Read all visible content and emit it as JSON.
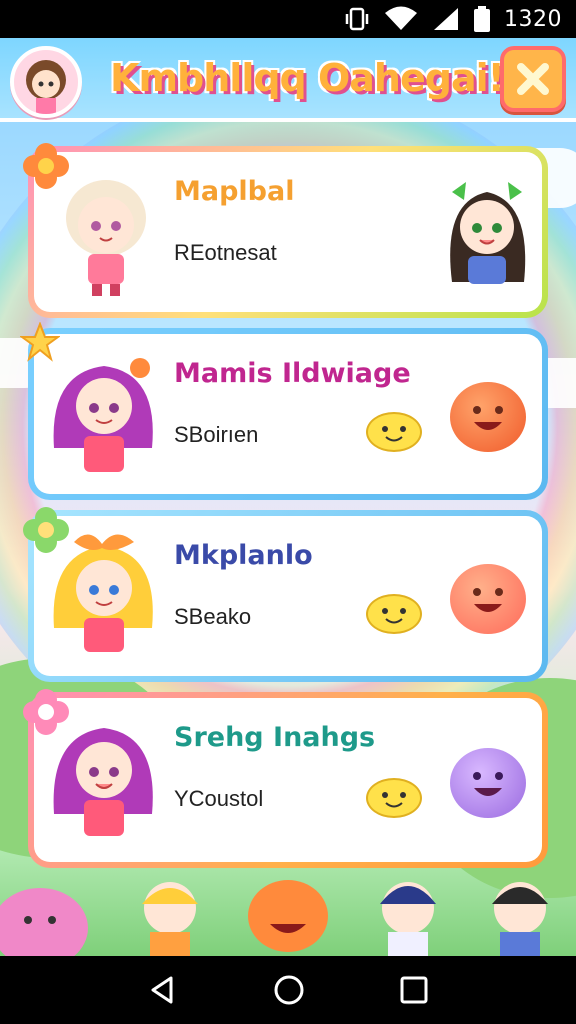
{
  "status_bar": {
    "time": "1320",
    "icons": [
      "vibrate-icon",
      "wifi-icon",
      "signal-icon",
      "battery-icon"
    ]
  },
  "header": {
    "title": "Kmbhllqq Oahegai!",
    "close_icon": "close-icon"
  },
  "cards": [
    {
      "name": "Maplbal",
      "subtitle": "REotnesat",
      "name_color": "#f5a030",
      "border": "#b8e34a"
    },
    {
      "name": "Mamis Ildwiage",
      "subtitle": "SBoirıen",
      "name_color": "#c0268f",
      "border": "#5bb8f0"
    },
    {
      "name": "Mkplanlo",
      "subtitle": "SBeako",
      "name_color": "#3a4aa8",
      "border": "#5bb8f0"
    },
    {
      "name": "Srehg Inahgs",
      "subtitle": "YCoustol",
      "name_color": "#1e9a8a",
      "border": "#ff9a3c"
    }
  ],
  "nav": {
    "back": "back-icon",
    "home": "home-icon",
    "recents": "recents-icon"
  }
}
